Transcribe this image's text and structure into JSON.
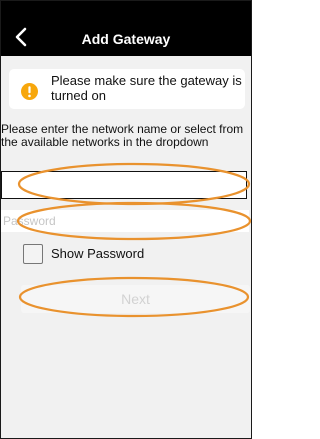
{
  "header": {
    "title": "Add Gateway",
    "back_icon": "chevron-left-icon"
  },
  "notice": {
    "icon": "info-icon",
    "text": "Please make sure the gateway is turned on"
  },
  "form": {
    "instructions": "Please enter the network name or select from the available networks in the dropdown",
    "network_value": "",
    "password_placeholder": "Password",
    "show_password_label": "Show Password",
    "show_password_checked": false,
    "next_label": "Next"
  },
  "colors": {
    "header_bg": "#000000",
    "info_icon": "#f7a70c",
    "highlight": "#e9922e"
  }
}
